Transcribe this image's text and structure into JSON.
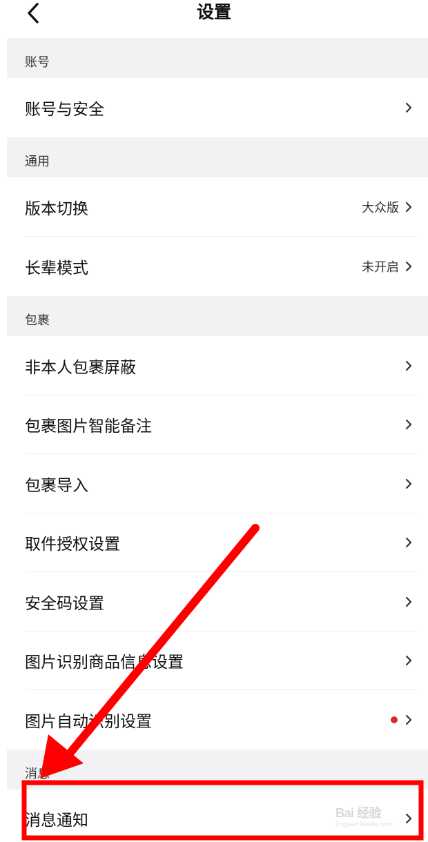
{
  "header": {
    "title": "设置",
    "back_icon": "chevron-left-icon"
  },
  "sections": [
    {
      "title": "账号",
      "items": [
        {
          "label": "账号与安全",
          "value": ""
        }
      ]
    },
    {
      "title": "通用",
      "items": [
        {
          "label": "版本切换",
          "value": "大众版"
        },
        {
          "label": "长辈模式",
          "value": "未开启"
        }
      ]
    },
    {
      "title": "包裹",
      "items": [
        {
          "label": "非本人包裹屏蔽",
          "value": ""
        },
        {
          "label": "包裹图片智能备注",
          "value": ""
        },
        {
          "label": "包裹导入",
          "value": ""
        },
        {
          "label": "取件授权设置",
          "value": ""
        },
        {
          "label": "安全码设置",
          "value": ""
        },
        {
          "label": "图片识别商品信息设置",
          "value": ""
        },
        {
          "label": "图片自动识别设置",
          "value": "",
          "badge": "red-dot"
        }
      ]
    },
    {
      "title": "消息",
      "items": [
        {
          "label": "消息通知",
          "value": ""
        }
      ]
    }
  ],
  "annotation": {
    "color": "#ff0000",
    "target": "消息通知"
  },
  "watermark": {
    "text": "Bai 经验",
    "sub": "jingyan.baidu.com"
  },
  "colors": {
    "section_bg": "#f2f2f4",
    "badge": "#d42a2a"
  }
}
